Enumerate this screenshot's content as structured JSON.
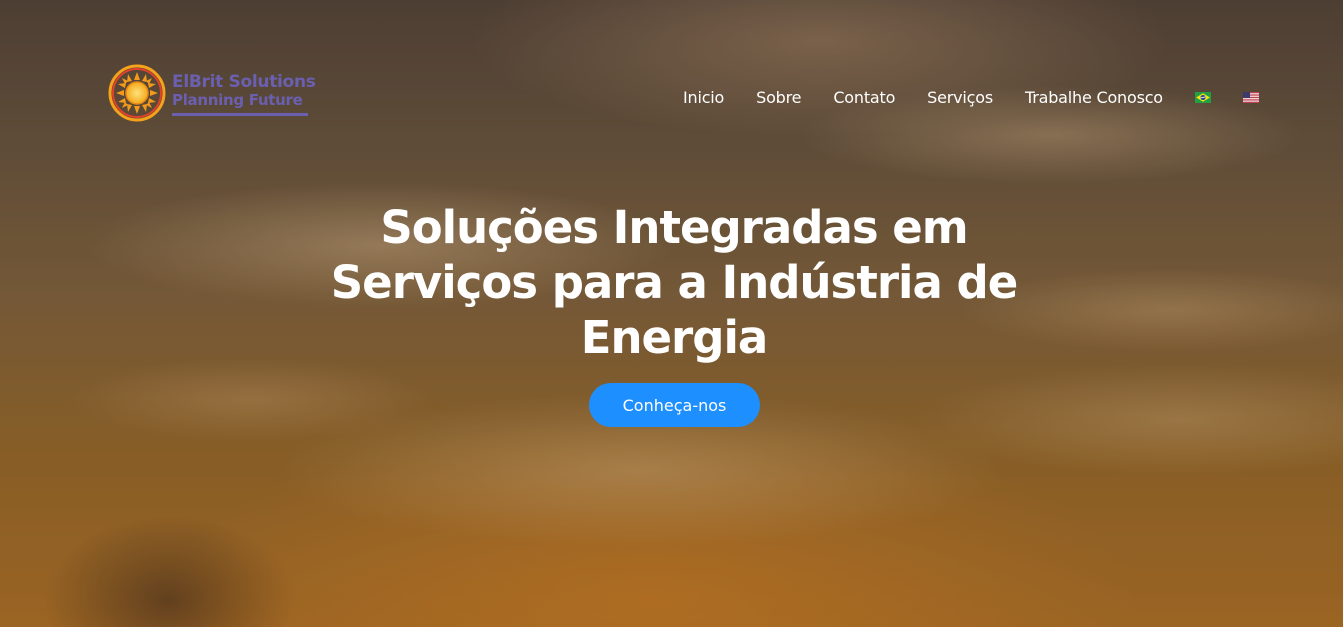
{
  "brand": {
    "name": "ElBrit Solutions",
    "tagline": "Planning Future",
    "logo_icon": "sun-icon",
    "color": "#6b5fb0"
  },
  "nav": {
    "items": [
      {
        "label": "Inicio"
      },
      {
        "label": "Sobre"
      },
      {
        "label": "Contato"
      },
      {
        "label": "Serviços"
      },
      {
        "label": "Trabalhe Conosco"
      }
    ],
    "languages": [
      {
        "icon": "brazil-flag-icon"
      },
      {
        "icon": "usa-flag-icon"
      }
    ]
  },
  "hero": {
    "headline": "Soluções Integradas em Serviços para a Indústria de Energia",
    "cta_label": "Conheça-nos",
    "cta_color": "#1e8fff",
    "background": "sunset-clouds-image"
  }
}
